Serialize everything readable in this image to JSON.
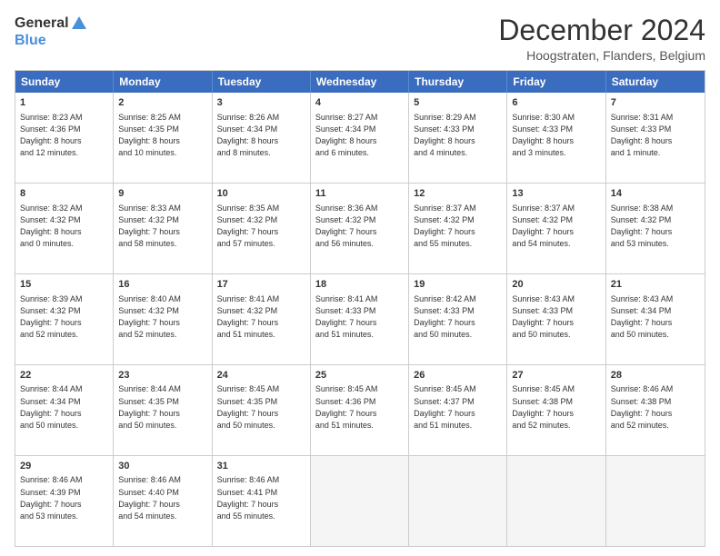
{
  "header": {
    "logo": {
      "text1": "General",
      "text2": "Blue"
    },
    "title": "December 2024",
    "subtitle": "Hoogstraten, Flanders, Belgium"
  },
  "calendar": {
    "days": [
      "Sunday",
      "Monday",
      "Tuesday",
      "Wednesday",
      "Thursday",
      "Friday",
      "Saturday"
    ],
    "weeks": [
      [
        {
          "day": "1",
          "info": "Sunrise: 8:23 AM\nSunset: 4:36 PM\nDaylight: 8 hours\nand 12 minutes."
        },
        {
          "day": "2",
          "info": "Sunrise: 8:25 AM\nSunset: 4:35 PM\nDaylight: 8 hours\nand 10 minutes."
        },
        {
          "day": "3",
          "info": "Sunrise: 8:26 AM\nSunset: 4:34 PM\nDaylight: 8 hours\nand 8 minutes."
        },
        {
          "day": "4",
          "info": "Sunrise: 8:27 AM\nSunset: 4:34 PM\nDaylight: 8 hours\nand 6 minutes."
        },
        {
          "day": "5",
          "info": "Sunrise: 8:29 AM\nSunset: 4:33 PM\nDaylight: 8 hours\nand 4 minutes."
        },
        {
          "day": "6",
          "info": "Sunrise: 8:30 AM\nSunset: 4:33 PM\nDaylight: 8 hours\nand 3 minutes."
        },
        {
          "day": "7",
          "info": "Sunrise: 8:31 AM\nSunset: 4:33 PM\nDaylight: 8 hours\nand 1 minute."
        }
      ],
      [
        {
          "day": "8",
          "info": "Sunrise: 8:32 AM\nSunset: 4:32 PM\nDaylight: 8 hours\nand 0 minutes."
        },
        {
          "day": "9",
          "info": "Sunrise: 8:33 AM\nSunset: 4:32 PM\nDaylight: 7 hours\nand 58 minutes."
        },
        {
          "day": "10",
          "info": "Sunrise: 8:35 AM\nSunset: 4:32 PM\nDaylight: 7 hours\nand 57 minutes."
        },
        {
          "day": "11",
          "info": "Sunrise: 8:36 AM\nSunset: 4:32 PM\nDaylight: 7 hours\nand 56 minutes."
        },
        {
          "day": "12",
          "info": "Sunrise: 8:37 AM\nSunset: 4:32 PM\nDaylight: 7 hours\nand 55 minutes."
        },
        {
          "day": "13",
          "info": "Sunrise: 8:37 AM\nSunset: 4:32 PM\nDaylight: 7 hours\nand 54 minutes."
        },
        {
          "day": "14",
          "info": "Sunrise: 8:38 AM\nSunset: 4:32 PM\nDaylight: 7 hours\nand 53 minutes."
        }
      ],
      [
        {
          "day": "15",
          "info": "Sunrise: 8:39 AM\nSunset: 4:32 PM\nDaylight: 7 hours\nand 52 minutes."
        },
        {
          "day": "16",
          "info": "Sunrise: 8:40 AM\nSunset: 4:32 PM\nDaylight: 7 hours\nand 52 minutes."
        },
        {
          "day": "17",
          "info": "Sunrise: 8:41 AM\nSunset: 4:32 PM\nDaylight: 7 hours\nand 51 minutes."
        },
        {
          "day": "18",
          "info": "Sunrise: 8:41 AM\nSunset: 4:33 PM\nDaylight: 7 hours\nand 51 minutes."
        },
        {
          "day": "19",
          "info": "Sunrise: 8:42 AM\nSunset: 4:33 PM\nDaylight: 7 hours\nand 50 minutes."
        },
        {
          "day": "20",
          "info": "Sunrise: 8:43 AM\nSunset: 4:33 PM\nDaylight: 7 hours\nand 50 minutes."
        },
        {
          "day": "21",
          "info": "Sunrise: 8:43 AM\nSunset: 4:34 PM\nDaylight: 7 hours\nand 50 minutes."
        }
      ],
      [
        {
          "day": "22",
          "info": "Sunrise: 8:44 AM\nSunset: 4:34 PM\nDaylight: 7 hours\nand 50 minutes."
        },
        {
          "day": "23",
          "info": "Sunrise: 8:44 AM\nSunset: 4:35 PM\nDaylight: 7 hours\nand 50 minutes."
        },
        {
          "day": "24",
          "info": "Sunrise: 8:45 AM\nSunset: 4:35 PM\nDaylight: 7 hours\nand 50 minutes."
        },
        {
          "day": "25",
          "info": "Sunrise: 8:45 AM\nSunset: 4:36 PM\nDaylight: 7 hours\nand 51 minutes."
        },
        {
          "day": "26",
          "info": "Sunrise: 8:45 AM\nSunset: 4:37 PM\nDaylight: 7 hours\nand 51 minutes."
        },
        {
          "day": "27",
          "info": "Sunrise: 8:45 AM\nSunset: 4:38 PM\nDaylight: 7 hours\nand 52 minutes."
        },
        {
          "day": "28",
          "info": "Sunrise: 8:46 AM\nSunset: 4:38 PM\nDaylight: 7 hours\nand 52 minutes."
        }
      ],
      [
        {
          "day": "29",
          "info": "Sunrise: 8:46 AM\nSunset: 4:39 PM\nDaylight: 7 hours\nand 53 minutes."
        },
        {
          "day": "30",
          "info": "Sunrise: 8:46 AM\nSunset: 4:40 PM\nDaylight: 7 hours\nand 54 minutes."
        },
        {
          "day": "31",
          "info": "Sunrise: 8:46 AM\nSunset: 4:41 PM\nDaylight: 7 hours\nand 55 minutes."
        },
        {
          "day": "",
          "info": ""
        },
        {
          "day": "",
          "info": ""
        },
        {
          "day": "",
          "info": ""
        },
        {
          "day": "",
          "info": ""
        }
      ]
    ]
  }
}
